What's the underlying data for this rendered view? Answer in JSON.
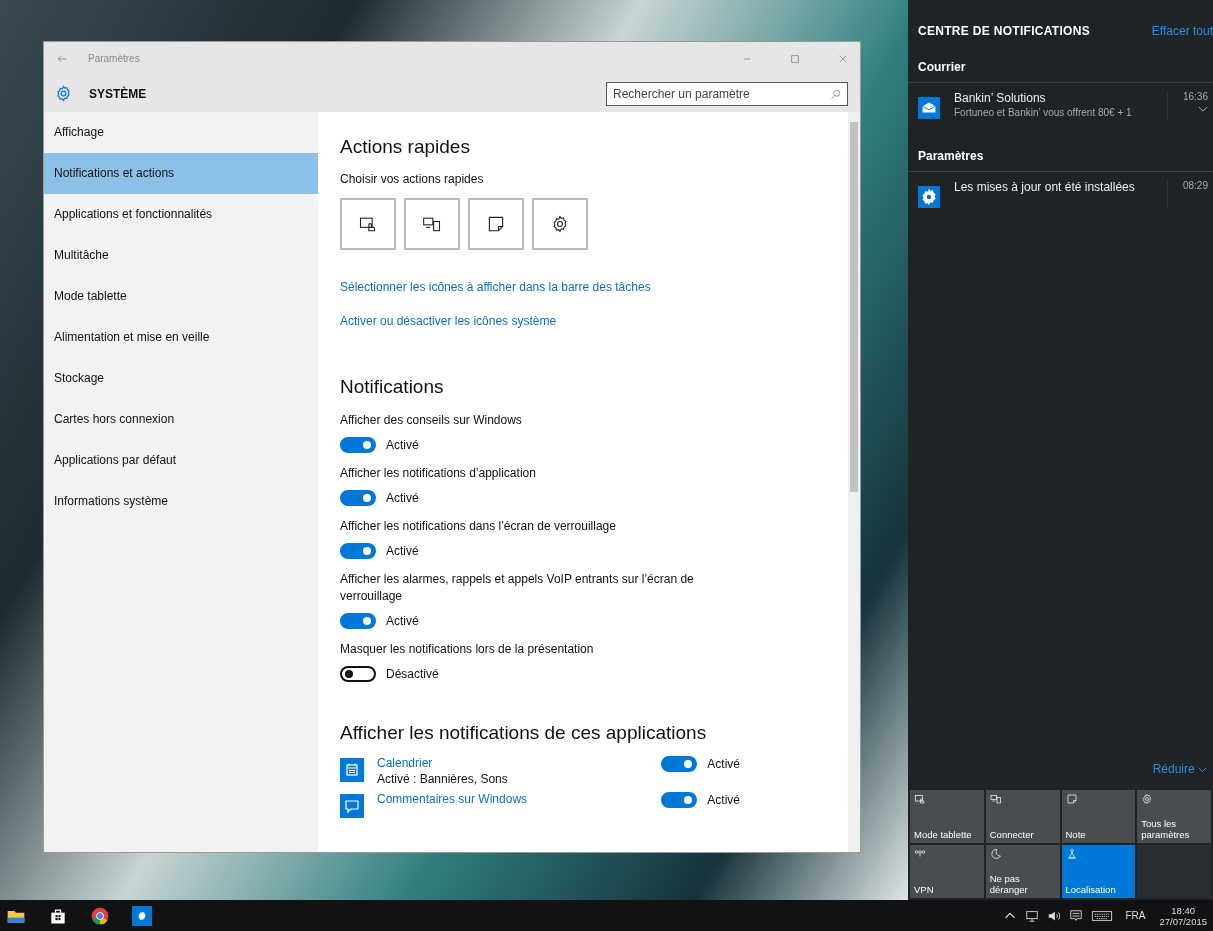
{
  "settings_window": {
    "title": "Paramètres",
    "header": {
      "title": "SYSTÈME",
      "search": {
        "placeholder": "Rechercher un paramètre"
      }
    },
    "sidebar": {
      "items": [
        {
          "label": "Affichage",
          "selected": false
        },
        {
          "label": "Notifications et actions",
          "selected": true
        },
        {
          "label": "Applications et fonctionnalités",
          "selected": false
        },
        {
          "label": "Multitâche",
          "selected": false
        },
        {
          "label": "Mode tablette",
          "selected": false
        },
        {
          "label": "Alimentation et mise en veille",
          "selected": false
        },
        {
          "label": "Stockage",
          "selected": false
        },
        {
          "label": "Cartes hors connexion",
          "selected": false
        },
        {
          "label": "Applications par défaut",
          "selected": false
        },
        {
          "label": "Informations système",
          "selected": false
        }
      ]
    },
    "content": {
      "quick_actions": {
        "heading": "Actions rapides",
        "subtitle": "Choisir vos actions rapides",
        "buttons": [
          {
            "kind": "tablet"
          },
          {
            "kind": "connect"
          },
          {
            "kind": "note"
          },
          {
            "kind": "settings"
          }
        ]
      },
      "links": [
        "Sélectionner les icônes à afficher dans la barre des tâches",
        "Activer ou désactiver les icônes système"
      ],
      "notifications": {
        "heading": "Notifications",
        "settings": [
          {
            "label": "Afficher des conseils sur Windows",
            "on": true,
            "state_label": "Activé"
          },
          {
            "label": "Afficher les notifications d’application",
            "on": true,
            "state_label": "Activé"
          },
          {
            "label": "Afficher les notifications dans l’écran de verrouillage",
            "on": true,
            "state_label": "Activé"
          },
          {
            "label": "Afficher les alarmes, rappels et appels VoIP entrants sur l’écran de verrouillage",
            "on": true,
            "state_label": "Activé"
          },
          {
            "label": "Masquer les notifications lors de la présentation",
            "on": false,
            "state_label": "Désactivé"
          }
        ]
      },
      "apps": {
        "heading": "Afficher les notifications de ces applications",
        "items": [
          {
            "kind": "calendar",
            "name": "Calendrier",
            "detail": "Activé : Bannières, Sons",
            "on": true,
            "state_label": "Activé"
          },
          {
            "kind": "feedback",
            "name": "Commentaires sur Windows",
            "on": true,
            "state_label": "Activé"
          }
        ]
      }
    }
  },
  "notification_center": {
    "title": "CENTRE DE NOTIFICATIONS",
    "clear": "Effacer tout",
    "groups": [
      {
        "name": "Courrier",
        "items": [
          {
            "kind": "mail",
            "title": "Bankin’ Solutions",
            "body": "Fortuneo et Bankin’ vous offrent 80€ + 1",
            "time": "16:36",
            "expandable": true
          }
        ]
      },
      {
        "name": "Paramètres",
        "items": [
          {
            "kind": "settings",
            "title": "Les mises à jour ont été installées",
            "time": "08:29",
            "expandable": false
          }
        ]
      }
    ],
    "collapse": "Réduire",
    "quick_actions": [
      {
        "kind": "tablet",
        "label": "Mode tablette",
        "on": false
      },
      {
        "kind": "connect",
        "label": "Connecter",
        "on": false
      },
      {
        "kind": "note",
        "label": "Note",
        "on": false
      },
      {
        "kind": "settings",
        "label": "Tous les paramètres",
        "on": false
      },
      {
        "kind": "vpn",
        "label": "VPN",
        "on": false
      },
      {
        "kind": "moon",
        "label": "Ne pas déranger",
        "on": false
      },
      {
        "kind": "location",
        "label": "Localisation",
        "on": true
      }
    ]
  },
  "taskbar": {
    "apps": [
      {
        "kind": "folder"
      },
      {
        "kind": "store"
      },
      {
        "kind": "browser"
      },
      {
        "kind": "settings"
      }
    ],
    "tray": {
      "language": "FRA",
      "time": "18:40",
      "date": "27/07/2015"
    }
  }
}
